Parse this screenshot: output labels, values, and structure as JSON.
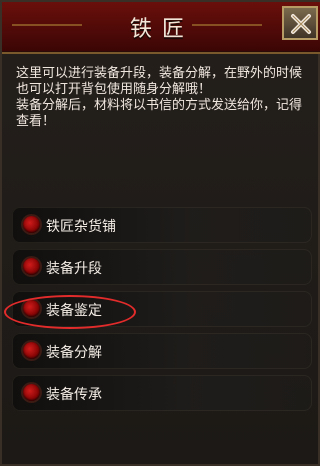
{
  "window": {
    "title": "铁匠"
  },
  "description": {
    "lines": [
      "这里可以进行装备升段，装备分解，在野外的时候",
      "也可以打开背包使用随身分解哦！",
      "装备分解后，材料将以书信的方式发送给你，记得",
      "查看！"
    ]
  },
  "menu": {
    "items": [
      {
        "label": "铁匠杂货铺"
      },
      {
        "label": "装备升段"
      },
      {
        "label": "装备鉴定"
      },
      {
        "label": "装备分解"
      },
      {
        "label": "装备传承"
      }
    ]
  },
  "colors": {
    "title_bg": "#6a0f0b",
    "panel_bg": "#1b1815",
    "bullet": "#c21414",
    "highlight": "#e22b2b"
  },
  "icons": {
    "close": "close-icon",
    "bullet": "red-bullet-icon"
  }
}
